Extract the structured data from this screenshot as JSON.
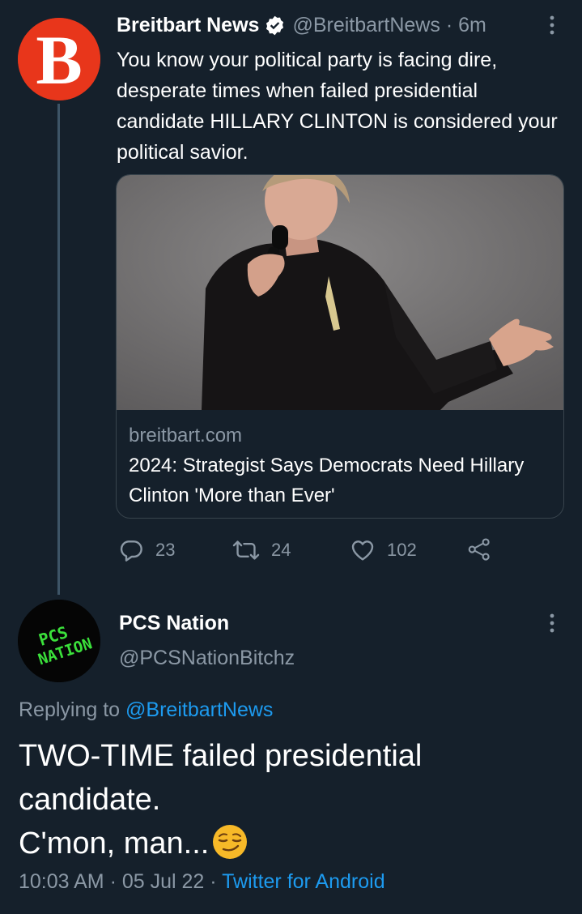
{
  "original_tweet": {
    "author_name": "Breitbart News",
    "handle": "@BreitbartNews",
    "separator": "·",
    "time_ago": "6m",
    "avatar_letter": "B",
    "text": "You know your political party is facing dire, desperate times when failed presidential candidate HILLARY CLINTON is considered your political savior.",
    "card": {
      "domain": "breitbart.com",
      "title": "2024: Strategist Says Democrats Need Hillary Clinton 'More than Ever'"
    },
    "actions": {
      "replies": "23",
      "retweets": "24",
      "likes": "102"
    }
  },
  "reply_tweet": {
    "author_name": "PCS Nation",
    "handle": "@PCSNationBitchz",
    "avatar_text_line1": "PCS",
    "avatar_text_line2": "NATION",
    "replying_prefix": "Replying to",
    "replying_to": "@BreitbartNews",
    "text_line1": "TWO-TIME failed presidential",
    "text_line2": "candidate.",
    "text_line3": "C'mon, man...",
    "time": "10:03 AM",
    "sep1": "·",
    "date": "05 Jul 22",
    "sep2": "·",
    "source": "Twitter for Android"
  },
  "colors": {
    "background": "#15202b",
    "secondary_text": "#8b98a5",
    "link": "#1d9bf0",
    "breitbart_red": "#e8361b",
    "pcs_green": "#3be03b"
  },
  "icons": [
    "more-vertical-icon",
    "verified-badge-icon",
    "reply-icon",
    "retweet-icon",
    "like-icon",
    "share-icon",
    "smirk-emoji-icon"
  ]
}
